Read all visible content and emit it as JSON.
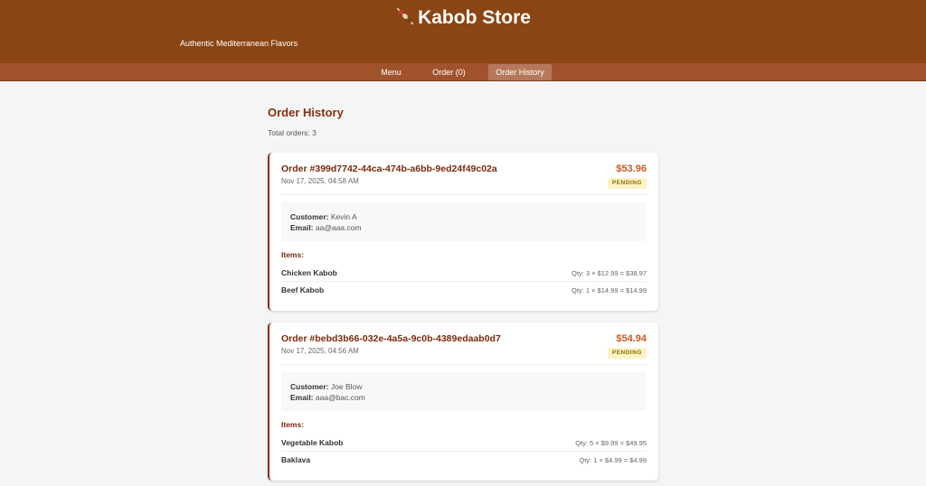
{
  "header": {
    "title": "Kabob Store",
    "logo_icon": "kabob-skewer-icon",
    "tagline": "Authentic Mediterranean Flavors",
    "background": "#8b4513"
  },
  "nav": {
    "items": [
      {
        "label": "Menu",
        "active": false
      },
      {
        "label": "Order (0)",
        "active": false
      },
      {
        "label": "Order History",
        "active": true
      }
    ]
  },
  "page": {
    "title": "Order History",
    "total_label": "Total orders:",
    "total_count": "3"
  },
  "labels": {
    "customer": "Customer:",
    "email": "Email:",
    "items": "Items:"
  },
  "orders": [
    {
      "id": "Order #399d7742-44ca-474b-a6bb-9ed24f49c02a",
      "date": "Nov 17, 2025, 04:58 AM",
      "total": "$53.96",
      "status": "PENDING",
      "customer": "Kevin A",
      "email": "aa@aaa.com",
      "items": [
        {
          "name": "Chicken Kabob",
          "qty": "Qty: 3 × $12.99 = $38.97"
        },
        {
          "name": "Beef Kabob",
          "qty": "Qty: 1 × $14.99 = $14.99"
        }
      ]
    },
    {
      "id": "Order #bebd3b66-032e-4a5a-9c0b-4389edaab0d7",
      "date": "Nov 17, 2025, 04:56 AM",
      "total": "$54.94",
      "status": "PENDING",
      "customer": "Joe Blow",
      "email": "aaa@bac.com",
      "items": [
        {
          "name": "Vegetable Kabob",
          "qty": "Qty: 5 × $9.99 = $49.95"
        },
        {
          "name": "Baklava",
          "qty": "Qty: 1 × $4.99 = $4.99"
        }
      ]
    }
  ],
  "colors": {
    "accent": "#8b2e0e",
    "price": "#cd5a1d",
    "badge_bg": "#fdf3c4",
    "badge_text": "#8a6d00"
  }
}
